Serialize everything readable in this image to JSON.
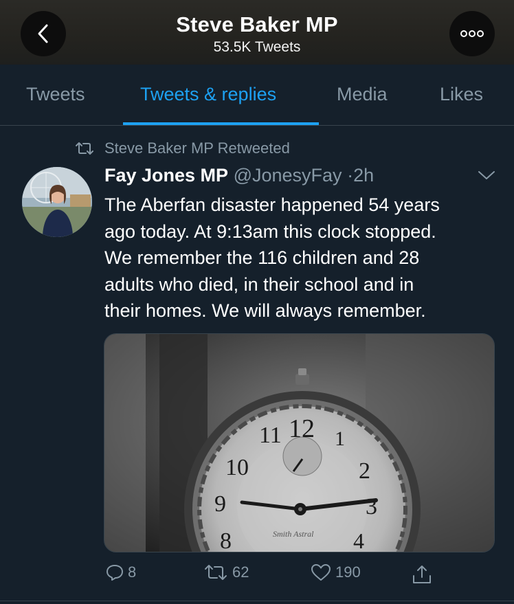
{
  "header": {
    "title": "Steve Baker MP",
    "subtitle": "53.5K Tweets",
    "back_icon": "chevron-left-icon",
    "more_icon": "more-icon"
  },
  "tabs": [
    {
      "label": "Tweets",
      "active": false
    },
    {
      "label": "Tweets & replies",
      "active": true
    },
    {
      "label": "Media",
      "active": false
    },
    {
      "label": "Likes",
      "active": false
    }
  ],
  "tweet": {
    "retweet_notice": "Steve Baker MP Retweeted",
    "author_name": "Fay Jones MP",
    "author_handle": "@JonesyFay",
    "separator": "·",
    "time": "2h",
    "text_lines": [
      "The Aberfan disaster happened 54 years",
      "ago today.  At 9:13am this clock stopped.",
      "We remember the 116 children and 28",
      "adults who died, in their school and in",
      "their homes.  We will always remember."
    ],
    "media_alt": "Black and white photo of a damaged clock stopped at 9:13",
    "clock_numerals": [
      "12",
      "11",
      "10",
      "9",
      "8",
      "1",
      "2",
      "3",
      "4"
    ],
    "clock_brand": "Smith Astral",
    "stats": {
      "replies": "8",
      "retweets": "62",
      "likes": "190"
    }
  },
  "colors": {
    "background": "#15202b",
    "accent": "#1da1f2",
    "muted": "#8899a6",
    "divider": "#38444d"
  }
}
